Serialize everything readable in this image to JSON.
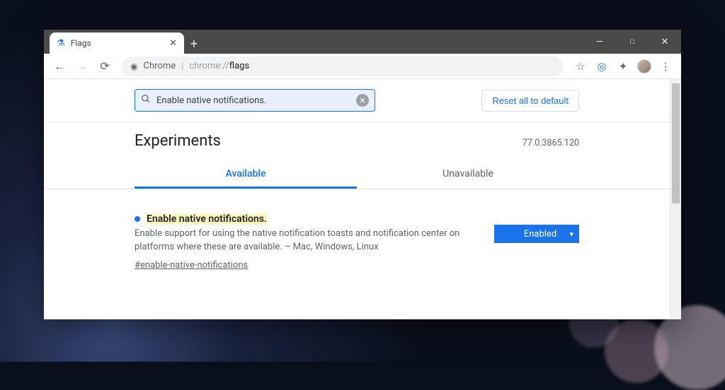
{
  "window": {
    "tab_title": "Flags",
    "controls": {
      "minimize": "—",
      "maximize": "□",
      "close": "✕"
    }
  },
  "toolbar": {
    "omnibox_prefix": "Chrome",
    "omnibox_path_dim": "chrome://",
    "omnibox_path_bold": "flags"
  },
  "search": {
    "query": "Enable native notifications.",
    "reset_label": "Reset all to default"
  },
  "header": {
    "title": "Experiments",
    "version": "77.0.3865.120"
  },
  "tabs": {
    "available": "Available",
    "unavailable": "Unavailable",
    "active": "available"
  },
  "flag": {
    "title": "Enable native notifications.",
    "description": "Enable support for using the native notification toasts and notification center on platforms where these are available. – Mac, Windows, Linux",
    "hash": "#enable-native-notifications",
    "select_value": "Enabled"
  }
}
